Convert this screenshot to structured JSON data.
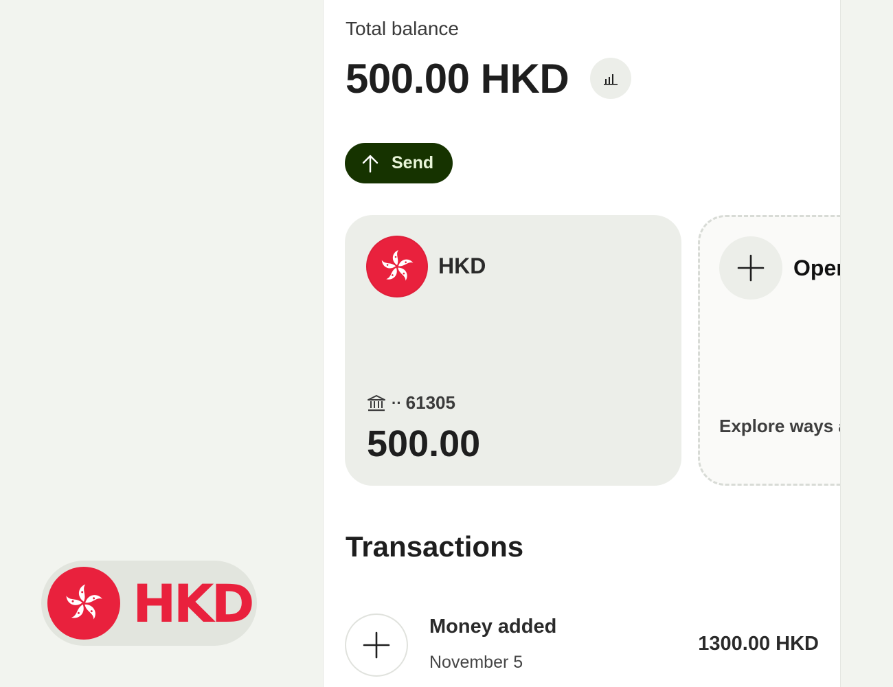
{
  "balance": {
    "label": "Total balance",
    "amount": "500.00 HKD"
  },
  "actions": {
    "send_label": "Send",
    "insights_icon": "bar-chart-icon"
  },
  "accounts": [
    {
      "currency": "HKD",
      "flag_icon": "hong-kong-flag-icon",
      "account_mask": "61305",
      "balance": "500.00"
    }
  ],
  "open_card": {
    "label": "Oper",
    "description": "Explore ways and grow your"
  },
  "transactions": {
    "title": "Transactions",
    "items": [
      {
        "name": "Money added",
        "date": "November 5",
        "amount": "1300.00 HKD",
        "icon": "plus-icon"
      }
    ]
  },
  "badge": {
    "text": "HKD",
    "flag_icon": "hong-kong-flag-icon"
  },
  "colors": {
    "page_bg": "#f2f4ef",
    "send_bg": "#163300",
    "hk_red": "#e9213d",
    "card_bg": "#eceee9"
  }
}
